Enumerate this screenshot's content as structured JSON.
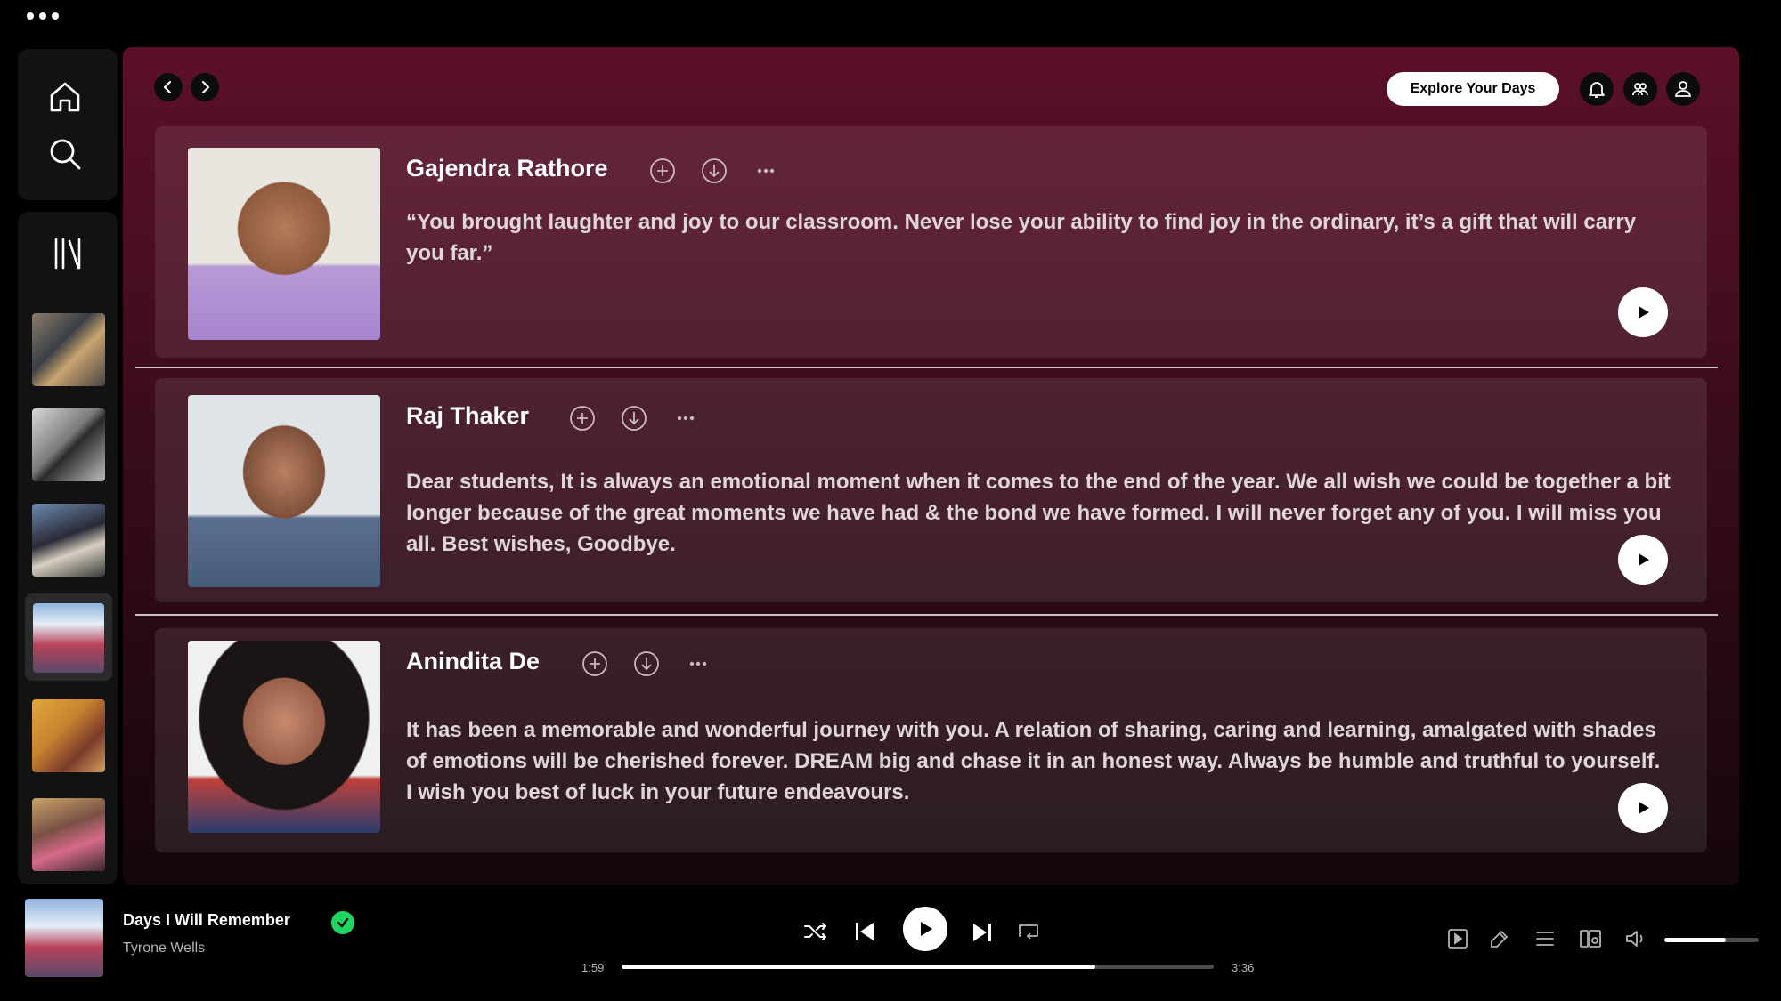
{
  "header": {
    "explore_label": "Explore Your Days"
  },
  "cards": [
    {
      "name": "Gajendra Rathore",
      "quote": "“You brought laughter and joy to our classroom. Never lose your ability to find joy in the ordinary, it’s a gift that will carry you far.”"
    },
    {
      "name": "Raj Thaker",
      "quote": "Dear students, It is always an emotional moment when it comes to the end of the year. We all wish we could be together a bit longer because of the great moments we have had & the bond we have formed. I will never forget any of you. I will miss you all. Best wishes, Goodbye."
    },
    {
      "name": "Anindita De",
      "quote": "It has been a memorable and wonderful journey with you. A relation of sharing, caring and learning, amalgated with shades of emotions will be cherished forever. DREAM big and chase it in an honest way. Always be humble and truthful to yourself. I wish you best of luck in your future endeavours."
    }
  ],
  "now_playing": {
    "title": "Days I Will Remember",
    "artist": "Tyrone Wells",
    "elapsed": "1:59",
    "duration": "3:36",
    "progress_fraction": 0.8,
    "volume_fraction": 0.65
  },
  "colors": {
    "accent_green": "#1ed760",
    "main_gradient_top": "#5c1028",
    "main_gradient_bottom": "#140609"
  },
  "icons": {
    "sidebar": [
      "home-icon",
      "search-icon",
      "library-icon"
    ],
    "card_actions": [
      "add-circle-icon",
      "download-icon",
      "more-icon"
    ],
    "player": [
      "shuffle-icon",
      "previous-icon",
      "play-icon",
      "next-icon",
      "repeat-icon"
    ],
    "extras": [
      "now-playing-view-icon",
      "lyrics-icon",
      "queue-icon",
      "connect-device-icon",
      "volume-icon"
    ]
  }
}
